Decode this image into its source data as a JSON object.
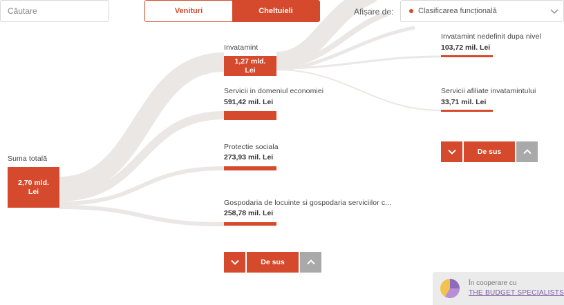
{
  "search": {
    "placeholder": "Căutare"
  },
  "toggle": {
    "venituri": "Venituri",
    "cheltuieli": "Cheltuieli"
  },
  "display": {
    "label": "Afișare de:",
    "selected": "Clasificarea funcțională"
  },
  "root": {
    "label": "Suma totală",
    "value_line1": "2,70 mld.",
    "value_line2": "Lei"
  },
  "level1": [
    {
      "label": "Invatamint",
      "value_line1": "1,27 mld.",
      "value_line2": "Lei"
    },
    {
      "label": "Servicii in domeniul economiei",
      "value": "591,42 mil. Lei"
    },
    {
      "label": "Protectie sociala",
      "value": "273,93 mil. Lei"
    },
    {
      "label": "Gospodaria de locuinte si gospodaria serviciilor c...",
      "value": "258,78 mil. Lei"
    }
  ],
  "level2": [
    {
      "label": "Invatamint nedefinit dupa nivel",
      "value": "103,72 mil. Lei"
    },
    {
      "label": "Servicii afiliate invatamintului",
      "value": "33,71 mil. Lei"
    }
  ],
  "pager": {
    "to_top": "De sus"
  },
  "cooperation": {
    "line1": "În cooperare cu",
    "line2": "THE BUDGET SPECIALISTS .e"
  },
  "colors": {
    "accent": "#d5492c",
    "flow": "#ebe7e5",
    "disabled": "#a9a9a9"
  },
  "icons": {
    "select_chevron": "chevron-down-icon",
    "pager_down": "chevron-down-icon",
    "pager_up": "chevron-up-icon",
    "logo": "pie-logo-icon"
  }
}
